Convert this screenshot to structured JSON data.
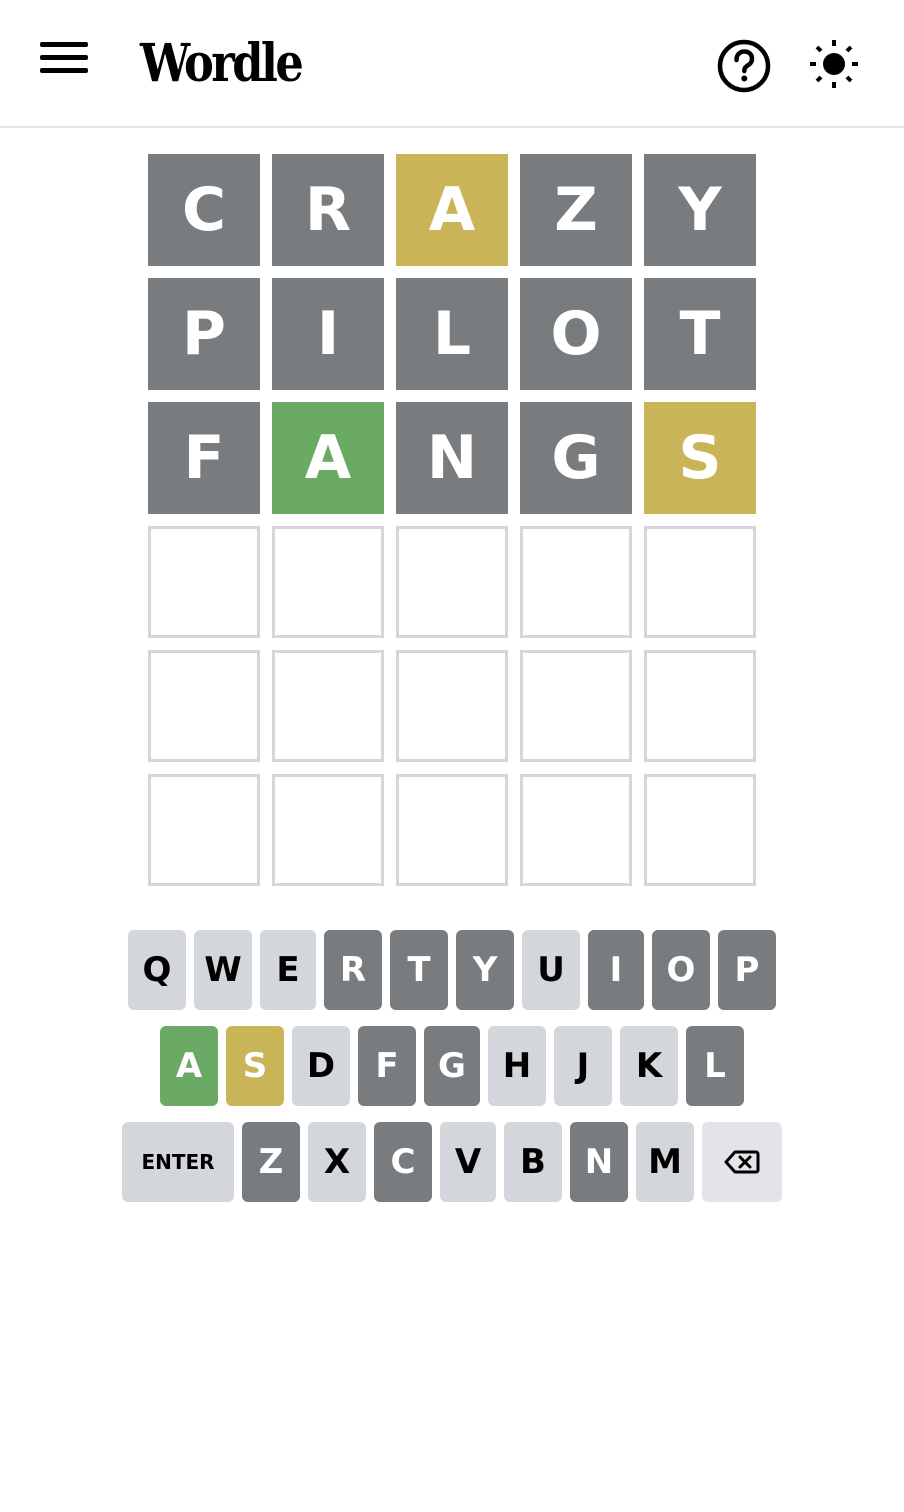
{
  "header": {
    "title": "Wordle",
    "menu_icon": "hamburger-menu-icon",
    "help_icon": "help-icon",
    "theme_icon": "sun-icon"
  },
  "colors": {
    "correct": "#6aaa64",
    "present": "#c9b458",
    "absent": "#787c7e",
    "unused_key": "#d3d6da",
    "empty_border": "#d3d6da"
  },
  "board": {
    "rows": [
      [
        {
          "letter": "C",
          "state": "absent"
        },
        {
          "letter": "R",
          "state": "absent"
        },
        {
          "letter": "A",
          "state": "present"
        },
        {
          "letter": "Z",
          "state": "absent"
        },
        {
          "letter": "Y",
          "state": "absent"
        }
      ],
      [
        {
          "letter": "P",
          "state": "absent"
        },
        {
          "letter": "I",
          "state": "absent"
        },
        {
          "letter": "L",
          "state": "absent"
        },
        {
          "letter": "O",
          "state": "absent"
        },
        {
          "letter": "T",
          "state": "absent"
        }
      ],
      [
        {
          "letter": "F",
          "state": "absent"
        },
        {
          "letter": "A",
          "state": "correct"
        },
        {
          "letter": "N",
          "state": "absent"
        },
        {
          "letter": "G",
          "state": "absent"
        },
        {
          "letter": "S",
          "state": "present"
        }
      ],
      [
        {
          "letter": "",
          "state": "empty"
        },
        {
          "letter": "",
          "state": "empty"
        },
        {
          "letter": "",
          "state": "empty"
        },
        {
          "letter": "",
          "state": "empty"
        },
        {
          "letter": "",
          "state": "empty"
        }
      ],
      [
        {
          "letter": "",
          "state": "empty"
        },
        {
          "letter": "",
          "state": "empty"
        },
        {
          "letter": "",
          "state": "empty"
        },
        {
          "letter": "",
          "state": "empty"
        },
        {
          "letter": "",
          "state": "empty"
        }
      ],
      [
        {
          "letter": "",
          "state": "empty"
        },
        {
          "letter": "",
          "state": "empty"
        },
        {
          "letter": "",
          "state": "empty"
        },
        {
          "letter": "",
          "state": "empty"
        },
        {
          "letter": "",
          "state": "empty"
        }
      ]
    ]
  },
  "keyboard": {
    "rows": [
      [
        {
          "label": "Q",
          "state": "unused"
        },
        {
          "label": "W",
          "state": "unused"
        },
        {
          "label": "E",
          "state": "unused"
        },
        {
          "label": "R",
          "state": "absent"
        },
        {
          "label": "T",
          "state": "absent"
        },
        {
          "label": "Y",
          "state": "absent"
        },
        {
          "label": "U",
          "state": "unused"
        },
        {
          "label": "I",
          "state": "absent"
        },
        {
          "label": "O",
          "state": "absent"
        },
        {
          "label": "P",
          "state": "absent"
        }
      ],
      [
        {
          "label": "A",
          "state": "correct"
        },
        {
          "label": "S",
          "state": "present"
        },
        {
          "label": "D",
          "state": "unused"
        },
        {
          "label": "F",
          "state": "absent"
        },
        {
          "label": "G",
          "state": "absent"
        },
        {
          "label": "H",
          "state": "unused"
        },
        {
          "label": "J",
          "state": "unused"
        },
        {
          "label": "K",
          "state": "unused"
        },
        {
          "label": "L",
          "state": "absent"
        }
      ],
      [
        {
          "label": "ENTER",
          "state": "unused",
          "kind": "enter"
        },
        {
          "label": "Z",
          "state": "absent"
        },
        {
          "label": "X",
          "state": "unused"
        },
        {
          "label": "C",
          "state": "absent"
        },
        {
          "label": "V",
          "state": "unused"
        },
        {
          "label": "B",
          "state": "unused"
        },
        {
          "label": "N",
          "state": "absent"
        },
        {
          "label": "M",
          "state": "unused"
        },
        {
          "label": "",
          "state": "unused",
          "kind": "backspace",
          "icon": "backspace-icon"
        }
      ]
    ]
  }
}
